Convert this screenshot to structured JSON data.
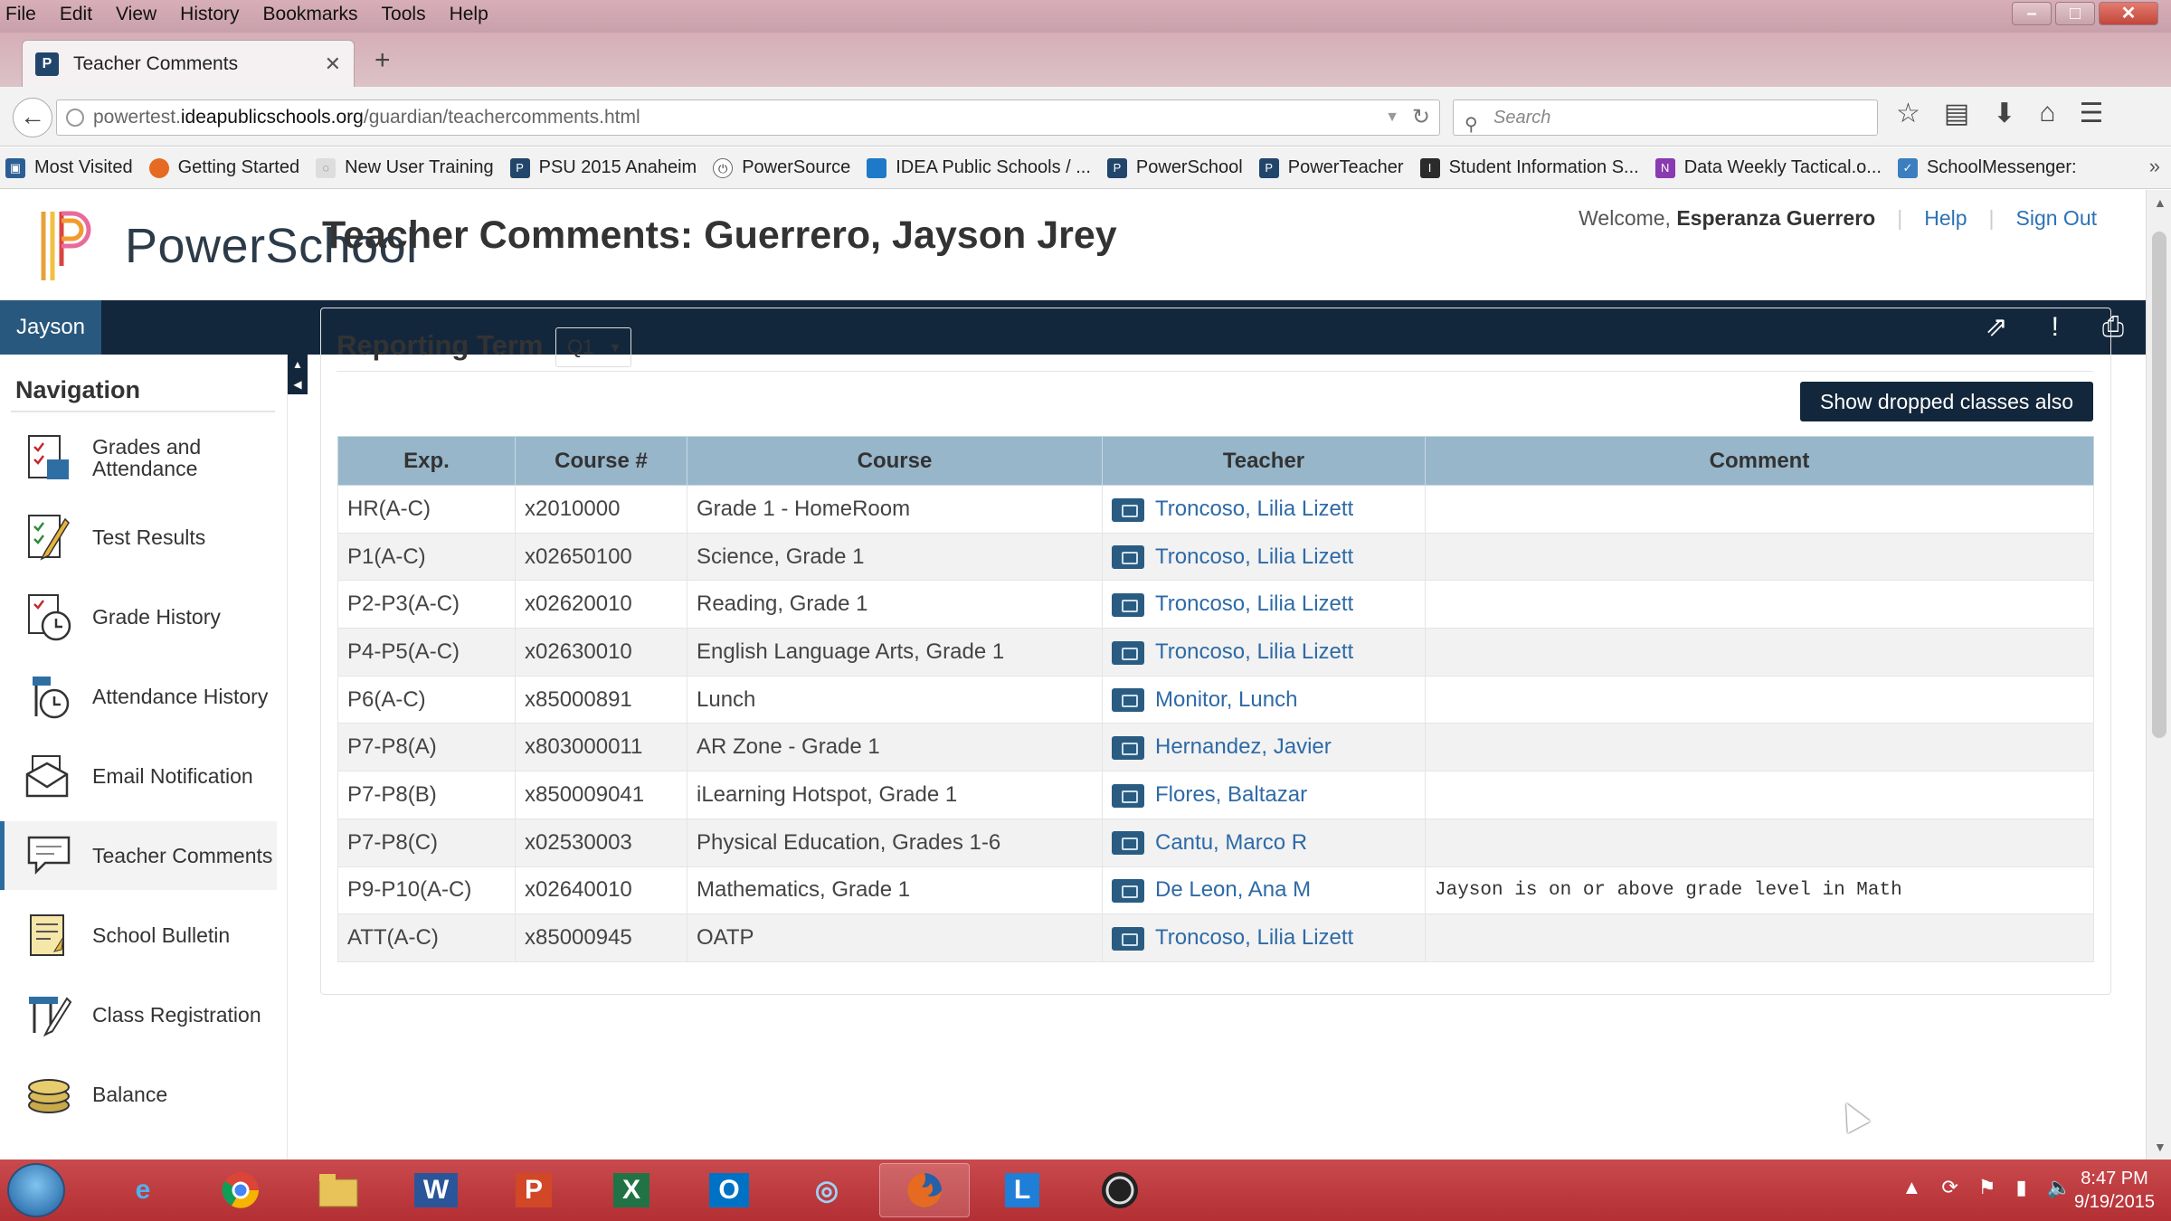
{
  "browser": {
    "menu": [
      "File",
      "Edit",
      "View",
      "History",
      "Bookmarks",
      "Tools",
      "Help"
    ],
    "tab_title": "Teacher Comments",
    "url_prefix": "powertest.",
    "url_domain": "ideapublicschools.org",
    "url_path": "/guardian/teachercomments.html",
    "search_placeholder": "Search",
    "bookmarks": [
      "Most Visited",
      "Getting Started",
      "New User Training",
      "PSU 2015 Anaheim",
      "PowerSource",
      "IDEA Public Schools / ...",
      "PowerSchool",
      "PowerTeacher",
      "Student Information S...",
      "Data Weekly Tactical.o...",
      "SchoolMessenger:"
    ]
  },
  "header": {
    "brand": "PowerSchool",
    "welcome": "Welcome,",
    "user_name": "Esperanza Guerrero",
    "help": "Help",
    "sign_out": "Sign Out",
    "student_tab": "Jayson"
  },
  "sidebar": {
    "heading": "Navigation",
    "items": [
      {
        "label": "Grades and Attendance"
      },
      {
        "label": "Test Results"
      },
      {
        "label": "Grade History"
      },
      {
        "label": "Attendance History"
      },
      {
        "label": "Email Notification"
      },
      {
        "label": "Teacher Comments"
      },
      {
        "label": "School Bulletin"
      },
      {
        "label": "Class Registration"
      },
      {
        "label": "Balance"
      }
    ]
  },
  "main": {
    "title": "Teacher Comments: Guerrero, Jayson Jrey",
    "reporting_term_label": "Reporting Term",
    "reporting_term_value": "Q1",
    "show_dropped_button": "Show dropped classes also",
    "columns": [
      "Exp.",
      "Course #",
      "Course",
      "Teacher",
      "Comment"
    ],
    "rows": [
      {
        "exp": "HR(A-C)",
        "course_num": "x2010000",
        "course": "Grade 1 - HomeRoom",
        "teacher": "Troncoso, Lilia Lizett",
        "comment": ""
      },
      {
        "exp": "P1(A-C)",
        "course_num": "x02650100",
        "course": "Science, Grade 1",
        "teacher": "Troncoso, Lilia Lizett",
        "comment": ""
      },
      {
        "exp": "P2-P3(A-C)",
        "course_num": "x02620010",
        "course": "Reading, Grade 1",
        "teacher": "Troncoso, Lilia Lizett",
        "comment": ""
      },
      {
        "exp": "P4-P5(A-C)",
        "course_num": "x02630010",
        "course": "English Language Arts, Grade 1",
        "teacher": "Troncoso, Lilia Lizett",
        "comment": ""
      },
      {
        "exp": "P6(A-C)",
        "course_num": "x85000891",
        "course": "Lunch",
        "teacher": "Monitor, Lunch",
        "comment": ""
      },
      {
        "exp": "P7-P8(A)",
        "course_num": "x803000011",
        "course": "AR Zone - Grade 1",
        "teacher": "Hernandez, Javier",
        "comment": ""
      },
      {
        "exp": "P7-P8(B)",
        "course_num": "x850009041",
        "course": "iLearning Hotspot, Grade 1",
        "teacher": "Flores, Baltazar",
        "comment": ""
      },
      {
        "exp": "P7-P8(C)",
        "course_num": "x02530003",
        "course": "Physical Education, Grades 1-6",
        "teacher": "Cantu, Marco R",
        "comment": ""
      },
      {
        "exp": "P9-P10(A-C)",
        "course_num": "x02640010",
        "course": "Mathematics, Grade 1",
        "teacher": "De Leon, Ana M",
        "comment": "Jayson is on or above grade level in Math"
      },
      {
        "exp": "ATT(A-C)",
        "course_num": "x85000945",
        "course": "OATP",
        "teacher": "Troncoso, Lilia Lizett",
        "comment": ""
      }
    ]
  },
  "taskbar": {
    "time": "8:47 PM",
    "date": "9/19/2015"
  },
  "colors": {
    "nav_dark": "#13273c",
    "header_blue": "#97b6ca",
    "link": "#2e6aa7",
    "taskbar": "#b32f34"
  }
}
